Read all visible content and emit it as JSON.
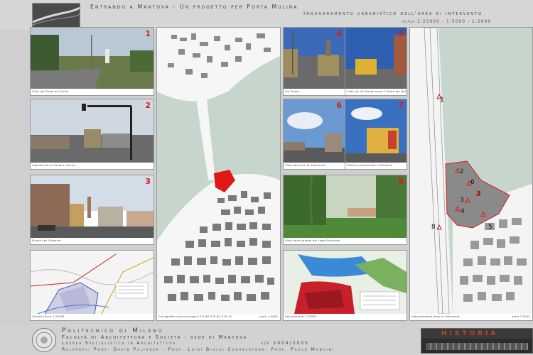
{
  "header": {
    "title": "Entrando a Mantova - Un progetto per Porta Mulina",
    "subtitle": "Inquadramento urbanistico dell'area di intervento",
    "scale": "scala 1:25000 - 1:5000 - 1:2000"
  },
  "photos": [
    {
      "number": "1",
      "caption": "Vista dal Ponte dei Mulini"
    },
    {
      "number": "2",
      "caption": "Ingresso di via Porto al centro"
    },
    {
      "number": "3",
      "caption": "Piazza San Giovanni"
    },
    {
      "number": "4",
      "caption": "Via Trento"
    },
    {
      "number": "5",
      "caption": "Vista da via Trento verso il Ponte dei Mulini"
    },
    {
      "number": "6",
      "caption": "Vista dell'area di intervento"
    },
    {
      "number": "7",
      "caption": "Edificio residenziale confinante"
    },
    {
      "number": "8",
      "caption": "Vista dalle sponde del Lago Superiore"
    }
  ],
  "maps": {
    "infrastructure_caption": "Infrastrutture 1:25000",
    "central_caption": "Cartografia numerica foglio E70-B1 E70-B3 E70-14",
    "central_scale": "scala 1:5000",
    "zoning_caption": "Zonizzazione 1:25000",
    "area_caption": "Individuazione area di intervento",
    "area_scale": "scala 1:2000",
    "area_markers": [
      "1",
      "2",
      "3",
      "4",
      "5",
      "6",
      "7",
      "8"
    ]
  },
  "footer": {
    "university": "Politecnico di Milano",
    "faculty": "Facoltà di Architettura e Società - sede di Mantova",
    "degree": "Laurea Specialistica in Architettura",
    "year": "a/a 2004/2005",
    "advisors": "Relatori: Prof. David Palterer - Prof. Luigi Biolzi  Correlatore: Prof. Paolo Mancini",
    "logo_text": "HISTORIA"
  },
  "colors": {
    "accent_red": "#e01818",
    "lake": "#c6d6cc",
    "background": "#cfcfcf"
  }
}
